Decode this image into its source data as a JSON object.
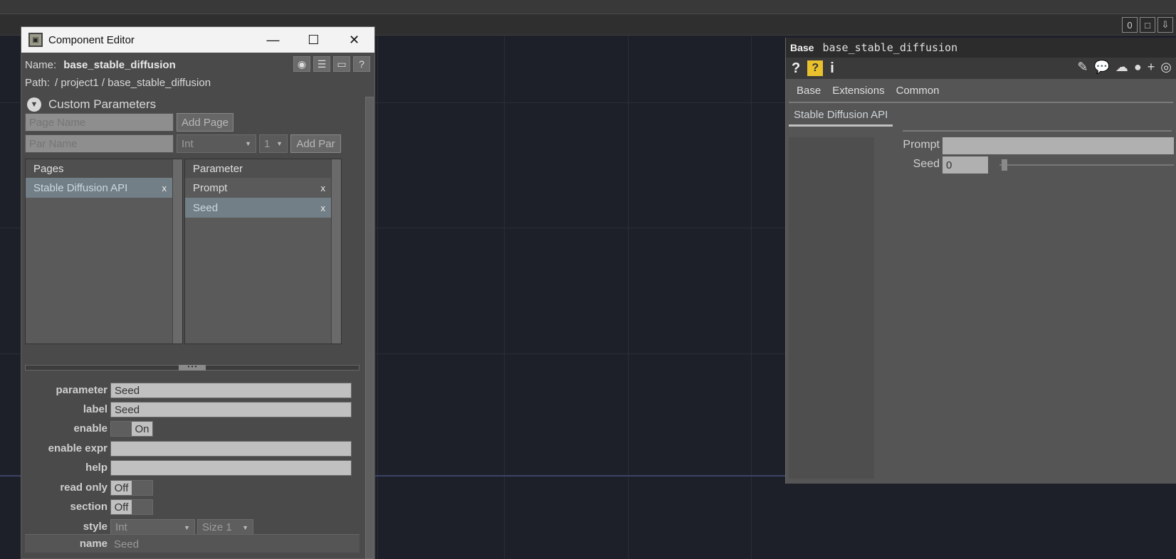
{
  "topbar": {
    "buttons": [
      "0",
      "□",
      "⇩"
    ]
  },
  "component_editor": {
    "title": "Component Editor",
    "name_label": "Name:",
    "name_value": "base_stable_diffusion",
    "path_label": "Path:",
    "path_value": "/ project1 / base_stable_diffusion",
    "section_title": "Custom Parameters",
    "page_name_placeholder": "Page Name",
    "add_page": "Add Page",
    "par_name_placeholder": "Par Name",
    "type_value": "Int",
    "size_value": "1",
    "add_par": "Add Par",
    "pages_header": "Pages",
    "pages": [
      {
        "label": "Stable Diffusion API",
        "remove": "x"
      }
    ],
    "parameter_header": "Parameter",
    "parameters": [
      {
        "label": "Prompt",
        "remove": "x"
      },
      {
        "label": "Seed",
        "remove": "x"
      }
    ],
    "props": {
      "parameter_label": "parameter",
      "parameter_value": "Seed",
      "label_label": "label",
      "label_value": "Seed",
      "enable_label": "enable",
      "enable_value": "On",
      "enable_expr_label": "enable expr",
      "enable_expr_value": "",
      "help_label": "help",
      "help_value": "",
      "read_only_label": "read only",
      "read_only_value": "Off",
      "section_label": "section",
      "section_value": "Off",
      "style_label": "style",
      "style_value": "Int",
      "style_size": "Size 1",
      "name_label": "name",
      "name_value": "Seed"
    }
  },
  "param_dialog": {
    "op_type": "Base",
    "op_name": "base_stable_diffusion",
    "tools_left": [
      "?",
      "?",
      "i"
    ],
    "tabs": [
      "Base",
      "Extensions",
      "Common"
    ],
    "page": "Stable Diffusion API",
    "prompt_label": "Prompt",
    "prompt_value": "",
    "seed_label": "Seed",
    "seed_value": "0"
  }
}
